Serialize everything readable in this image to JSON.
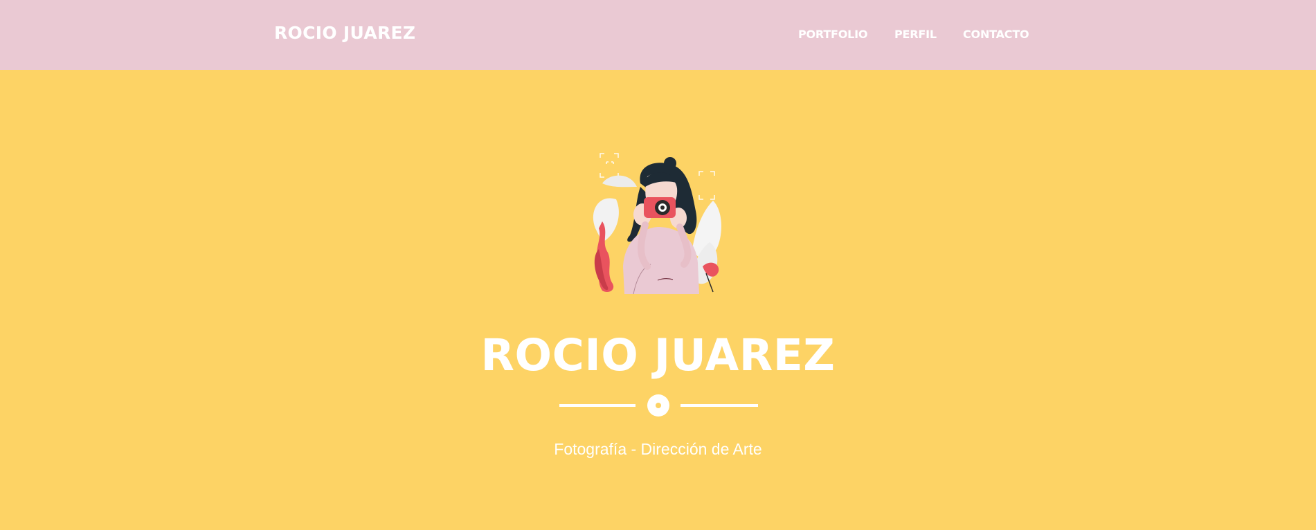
{
  "header": {
    "brand": "ROCIO JUAREZ",
    "nav": [
      {
        "label": "PORTFOLIO"
      },
      {
        "label": "PERFIL"
      },
      {
        "label": "CONTACTO"
      }
    ]
  },
  "hero": {
    "title": "ROCIO JUAREZ",
    "subtitle": "Fotografía - Dirección de Arte",
    "illustration_icon": "photographer-illustration",
    "divider_icon": "circle-star-icon"
  },
  "colors": {
    "header_bg": "#EAC9D3",
    "hero_bg": "#FDD365",
    "text": "#FFFFFF"
  }
}
